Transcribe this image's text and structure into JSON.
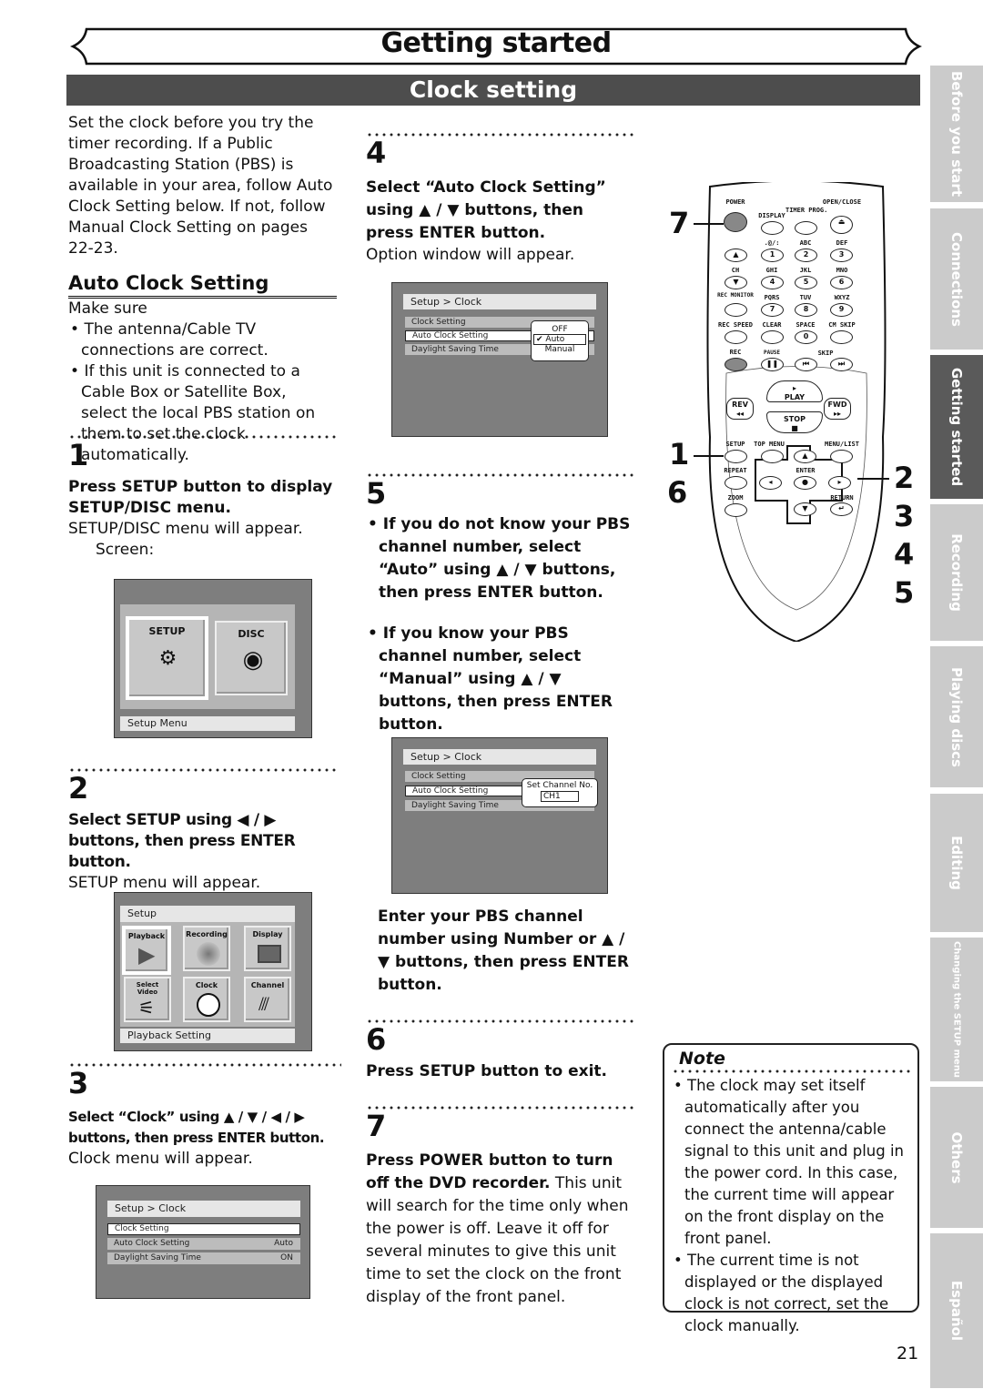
{
  "header": {
    "chapter_title": "Getting started",
    "section_title": "Clock setting"
  },
  "side_tabs": [
    {
      "label": "Before you start",
      "active": false
    },
    {
      "label": "Connections",
      "active": false
    },
    {
      "label": "Getting started",
      "active": true
    },
    {
      "label": "Recording",
      "active": false
    },
    {
      "label": "Playing discs",
      "active": false
    },
    {
      "label": "Editing",
      "active": false
    },
    {
      "label": "Changing the SETUP menu",
      "active": false
    },
    {
      "label": "Others",
      "active": false
    },
    {
      "label": "Español",
      "active": false
    }
  ],
  "intro": "Set the clock before you try the timer recording. If a Public Broadcasting Station (PBS) is available in your area, follow Auto Clock Setting below. If not, follow Manual Clock Setting on pages 22-23.",
  "auto_clock": {
    "heading": "Auto Clock Setting",
    "make_sure": "Make sure",
    "bullets": [
      "The antenna/Cable TV connections are correct.",
      "If this unit is connected to a Cable Box or Satellite Box, select the local PBS station on them to set the clock automatically."
    ]
  },
  "steps": {
    "s1": {
      "num": "1",
      "bold": "Press SETUP button to display SETUP/DISC menu.",
      "text": "SETUP/DISC menu will appear.",
      "sub": "Screen:"
    },
    "s2": {
      "num": "2",
      "bold": "Select SETUP using ◀ / ▶ buttons, then press ENTER button.",
      "text": "SETUP menu will appear."
    },
    "s3": {
      "num": "3",
      "bold": "Select “Clock” using ▲ / ▼ / ◀ / ▶ buttons, then press ENTER button.",
      "text": "Clock menu will appear."
    },
    "s4": {
      "num": "4",
      "bold": "Select “Auto Clock Setting” using ▲ / ▼ buttons, then press ENTER button.",
      "text": "Option window will appear."
    },
    "s5": {
      "num": "5",
      "bullet1": "If you do not know your PBS channel number, select “Auto” using ▲ / ▼ buttons, then press ENTER button.",
      "bullet2": "If you know your PBS channel number, select “Manual” using ▲ / ▼ buttons, then press ENTER button.",
      "after": "Enter your PBS channel number using Number or ▲ / ▼ buttons, then press ENTER button."
    },
    "s6": {
      "num": "6",
      "bold": "Press SETUP button to exit."
    },
    "s7": {
      "num": "7",
      "bold": "Press POWER button to turn off the DVD recorder.",
      "text": " This unit will search for the time only when the power is off. Leave it off for several minutes to give this unit time to set the clock on the front display of the front panel."
    }
  },
  "screens": {
    "setup_disc": {
      "tile1": "SETUP",
      "tile2": "DISC",
      "status": "Setup Menu"
    },
    "setup": {
      "title": "Setup",
      "tiles": [
        "Playback",
        "Recording",
        "Display",
        "Select Video",
        "Clock",
        "Channel"
      ],
      "status": "Playback Setting"
    },
    "clock": {
      "title": "Setup > Clock",
      "rows": [
        {
          "label": "Clock Setting",
          "value": ""
        },
        {
          "label": "Auto Clock Setting",
          "value": "Auto"
        },
        {
          "label": "Daylight Saving Time",
          "value": "ON"
        }
      ]
    },
    "option": {
      "title": "Setup > Clock",
      "rows": [
        "Clock Setting",
        "Auto Clock Setting",
        "Daylight Saving Time"
      ],
      "options": [
        "OFF",
        "Auto",
        "Manual"
      ],
      "selected": "Auto"
    },
    "channel": {
      "title": "Setup > Clock",
      "rows": [
        "Clock Setting",
        "Auto Clock Setting",
        "Daylight Saving Time"
      ],
      "popup_title": "Set Channel No.",
      "value": "CH1"
    }
  },
  "remote": {
    "labels": {
      "power": "POWER",
      "display": "DISPLAY",
      "timer": "TIMER PROG.",
      "open": "OPEN/CLOSE",
      "k1": ".@/:",
      "k2": "ABC",
      "k3": "DEF",
      "ch": "CH",
      "k4": "GHI",
      "k5": "JKL",
      "k6": "MNO",
      "recmon": "REC MONITOR",
      "k7": "PQRS",
      "k8": "TUV",
      "k9": "WXYZ",
      "recspeed": "REC SPEED",
      "clear": "CLEAR",
      "space": "SPACE",
      "cmskip": "CM SKIP",
      "rec": "REC",
      "pause": "PAUSE",
      "skip": "SKIP",
      "play": "PLAY",
      "rev": "REV",
      "fwd": "FWD",
      "stop": "STOP",
      "setup": "SETUP",
      "topmenu": "TOP MENU",
      "menulist": "MENU/LIST",
      "repeat": "REPEAT",
      "enter": "ENTER",
      "zoom": "ZOOM",
      "return": "RETURN"
    },
    "digits": [
      "1",
      "2",
      "3",
      "4",
      "5",
      "6",
      "7",
      "8",
      "9",
      "0"
    ],
    "callouts": {
      "left_top": "7",
      "left_mid1": "1",
      "left_mid2": "6",
      "right": [
        "2",
        "3",
        "4",
        "5"
      ]
    }
  },
  "note": {
    "title": "Note",
    "bullets": [
      "The clock may set itself automatically after you connect the antenna/cable signal to this unit and plug in the power cord. In this case, the current time will appear on the front display on the front panel.",
      "The current time is not displayed or the displayed clock is not correct, set the clock manually."
    ]
  },
  "page_number": "21"
}
